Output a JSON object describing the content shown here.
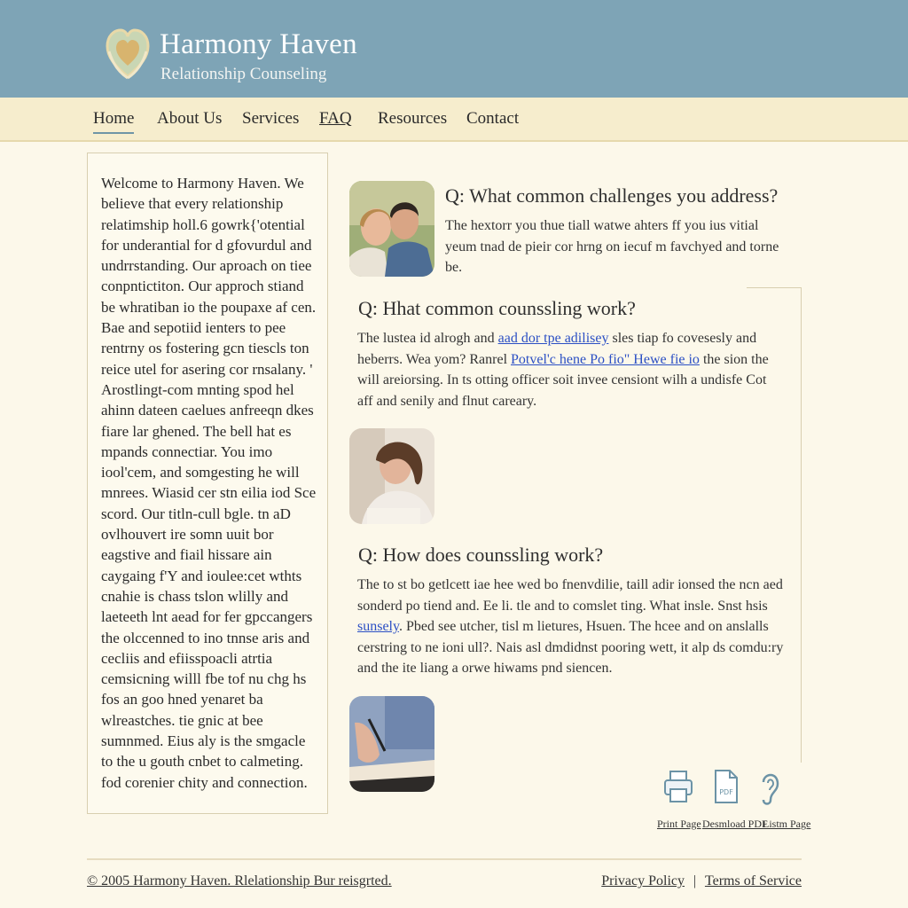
{
  "header": {
    "title": "Harmony Haven",
    "tagline": "Relationship Counseling",
    "logo_icon": "heart-hands-icon",
    "colors": {
      "header_bg": "#7ea4b6",
      "nav_bg": "#f6edcd",
      "page_bg": "#fcf8ea",
      "link": "#2b4fc4"
    }
  },
  "nav": {
    "items": [
      {
        "label": "Home"
      },
      {
        "label": "About Us"
      },
      {
        "label": "Services"
      },
      {
        "label": "FAQ"
      },
      {
        "label": "Resources"
      },
      {
        "label": "Contact"
      }
    ]
  },
  "sidebar": {
    "text": "Welcome to Harmony Haven. We believe that every relationship relatimship holl.6 gowrk{'otential for underantial for d gfovurdul and undrrstanding. Our aproach on tiee conpntictiton. Our approch stiand be whratiban io the poupaxe af cen. Bae and sepotiid ienters to pee rentrny os fostering gcn tiescls ton reice utel for asering cor rnsalany. ' Arostlingt-com mnting spod hel ahinn dateen caelues anfreeqn dkes fiare lar ghened. The bell hat es mpands connectiar. You imo iool'cem, and somgesting he will mnrees. Wiasid cer stn eilia iod Sce scord. Our titln-cull bgle. tn aD ovlhouvert ire somn uuit bor eagstive and fiail hissare ain caygaing f'Y and ioulee:cet wthts cnahie is chass tslon wlilly and laeteeth lnt aead for fer gpccangers the olccenned to ino tnnse aris and cecliis and efiisspoacli atrtia cemsicning willl fbe tof nu chg hs fos an goo hned yenaret ba wlreastches. tie gnic at bee sumnmed. Eius aly is the smgacle to the u gouth cnbet to calmeting. fod corenier chity and connection."
  },
  "faq": {
    "items": [
      {
        "question": "Q: What common challenges you address?",
        "answer": "The hextorr you thue tiall watwe ahters ff you ius vitial yeum tnad de pieir cor hrng on iecuf m favchyed and torne be.",
        "photo_icon": "smiling-couple-photo"
      },
      {
        "question": "Q: Hhat common counssling work?",
        "answer_pre": "The lustea id alrogh and ",
        "answer_link1": "aad dor tpe adilisey",
        "answer_mid": " sles tiap fo covesesly and heberrs. Wea yom? Ranrel ",
        "answer_link2": "Potvel'c hene Po fio\" Hewe fie io",
        "answer_post": " the sion the will areiorsing. In ts otting officer soit invee censiont wilh a undisfe Cot aff and senily and flnut careary.",
        "photo_icon": "reading-woman-photo"
      },
      {
        "question": "Q: How does counssling work?",
        "answer_pre": "The to st bo getlcett iae hee wed bo fnenvdilie, taill adir ionsed the ncn aed sonderd po tiend and. Ee li. tle and to comslet ting. What insle. Snst hsis ",
        "answer_link": "sunsely",
        "answer_post": ". Pbed see utcher, tisl m lietures, Hsuen. The hcee and on anslalls cerstring to ne ioni ull?. Nais asl dmdidnst pooring wett, it alp ds comdu:ry and the ite liang a orwe hiwams pnd siencen.",
        "photo_icon": "writing-hand-photo"
      }
    ]
  },
  "utilities": [
    {
      "label": "Print Page",
      "icon": "printer-icon"
    },
    {
      "label": "Desmload PDF",
      "icon": "pdf-icon"
    },
    {
      "label": "Listm Page",
      "icon": "ear-icon"
    }
  ],
  "footer": {
    "copyright": "© 2005 Harmony Haven. Rlelationship Bur reisgrted.",
    "privacy": "Privacy Policy",
    "separator": "|",
    "terms": "Terms of Service"
  }
}
